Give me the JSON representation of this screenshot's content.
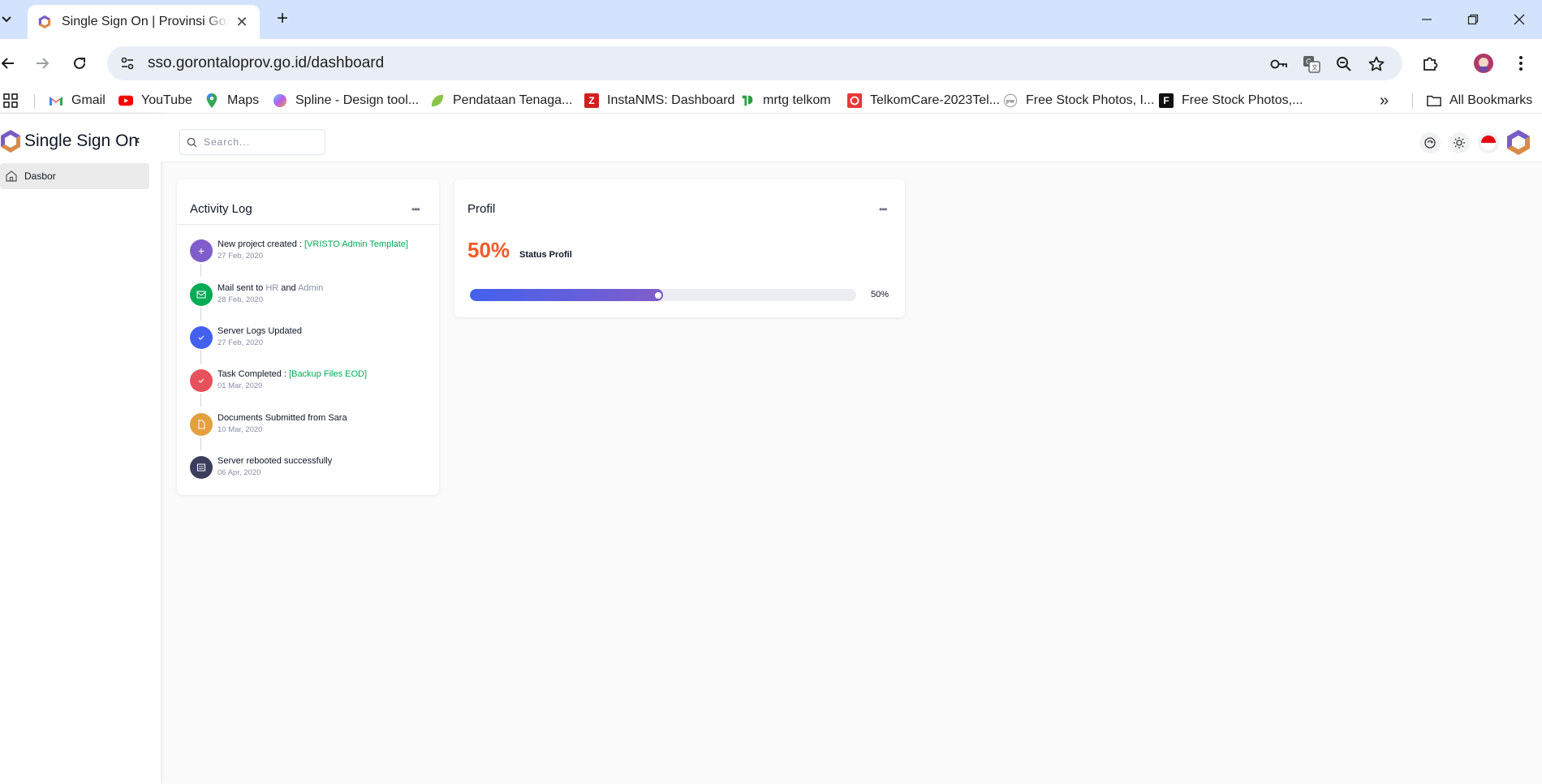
{
  "browser": {
    "tab_title": "Single Sign On | Provinsi Gorontalo",
    "url": "sso.gorontaloprov.go.id/dashboard",
    "bookmarks": [
      {
        "label": "Gmail",
        "icon": "gmail-icon"
      },
      {
        "label": "YouTube",
        "icon": "youtube-icon"
      },
      {
        "label": "Maps",
        "icon": "maps-icon"
      },
      {
        "label": "Spline - Design tool...",
        "icon": "spline-icon"
      },
      {
        "label": "Pendataan Tenaga...",
        "icon": "leaf-icon"
      },
      {
        "label": "InstaNMS: Dashboard",
        "icon": "z-icon"
      },
      {
        "label": "mrtg telkom",
        "icon": "mrtg-icon"
      },
      {
        "label": "TelkomCare-2023Tel...",
        "icon": "telkomcare-icon"
      },
      {
        "label": "Free Stock Photos, I...",
        "icon": "pw-icon"
      },
      {
        "label": "Free Stock Photos,...",
        "icon": "f-icon"
      }
    ],
    "all_bookmarks_label": "All Bookmarks"
  },
  "app": {
    "brand": "Single Sign On",
    "menu": [
      {
        "label": "Dasbor",
        "icon": "home-icon"
      }
    ],
    "search_placeholder": "Search..."
  },
  "activity": {
    "title": "Activity Log",
    "items": [
      {
        "text": "New project created : ",
        "highlight": "[VRISTO Admin Template]",
        "date": "27 Feb, 2020",
        "color": "#805dca",
        "icon": "plus-icon"
      },
      {
        "text_parts": [
          "Mail sent to ",
          "HR",
          " and ",
          "Admin"
        ],
        "date": "28 Feb, 2020",
        "color": "#00ab55",
        "icon": "mail-icon"
      },
      {
        "text": "Server Logs Updated",
        "date": "27 Feb, 2020",
        "color": "#4361ee",
        "icon": "check-icon"
      },
      {
        "text": "Task Completed : ",
        "highlight": "[Backup Files EOD]",
        "date": "01 Mar, 2020",
        "color": "#e7515a",
        "icon": "check-icon"
      },
      {
        "text": "Documents Submitted from Sara",
        "date": "10 Mar, 2020",
        "color": "#e2a03f",
        "icon": "file-icon"
      },
      {
        "text": "Server rebooted successfully",
        "date": "06 Apr, 2020",
        "color": "#3b3f5c",
        "icon": "server-icon"
      }
    ]
  },
  "profile": {
    "title": "Profil",
    "percent": "50%",
    "status_label": "Status Profil",
    "progress": 0.5,
    "progress_label": "50%"
  }
}
